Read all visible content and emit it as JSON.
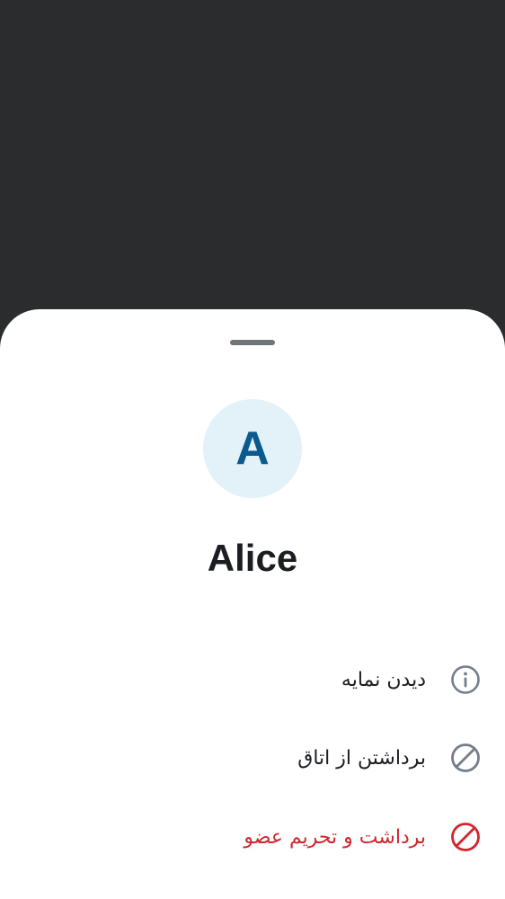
{
  "member": {
    "avatar_initial": "A",
    "name": "Alice"
  },
  "actions": [
    {
      "label": "دیدن نمایه",
      "icon": "info-icon",
      "color": "#737d8c"
    },
    {
      "label": "برداشتن از اتاق",
      "icon": "block-icon",
      "color": "#737d8c"
    },
    {
      "label": "برداشت و تحریم عضو",
      "icon": "ban-icon",
      "color": "#d1262d"
    }
  ],
  "colors": {
    "avatar_background": "#e2f2f8",
    "avatar_letter": "#0a5a8f",
    "danger": "#d1262d",
    "backdrop": "#2b2c2e"
  }
}
